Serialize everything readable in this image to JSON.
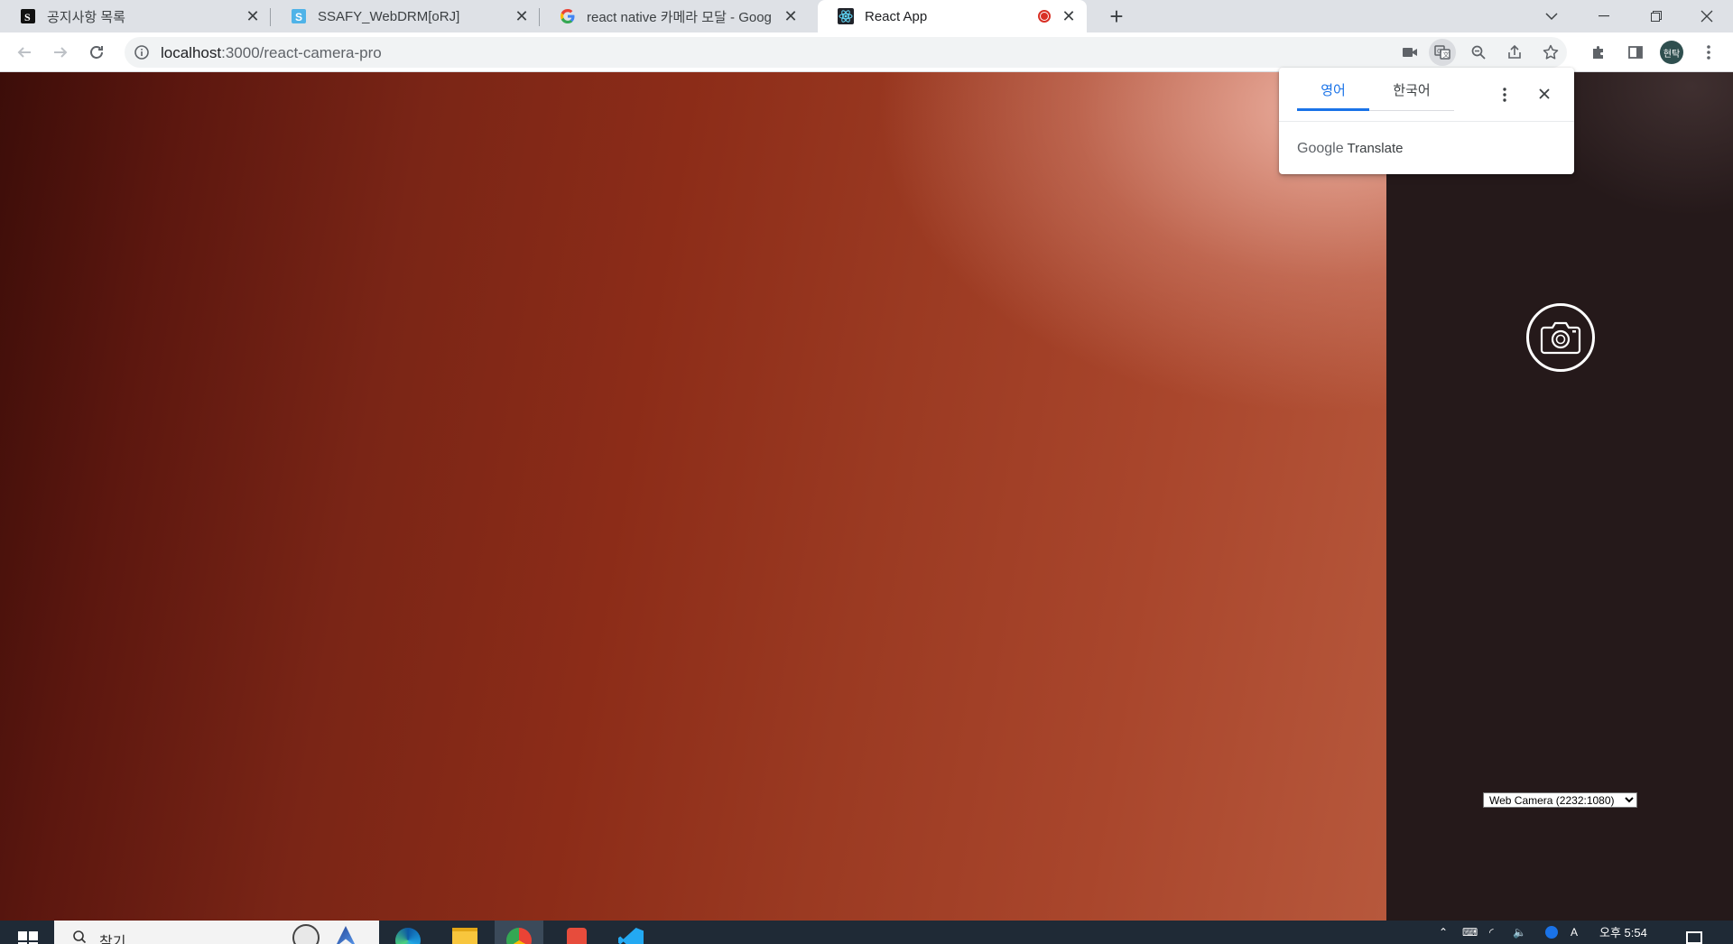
{
  "tabs": [
    {
      "title": "공지사항 목록",
      "favicon": "notion-icon"
    },
    {
      "title": "SSAFY_WebDRM[oRJ]",
      "favicon": "document-icon"
    },
    {
      "title": "react native 카메라 모달 - Goog",
      "favicon": "google-icon"
    },
    {
      "title": "React App",
      "favicon": "react-icon",
      "recording": true
    }
  ],
  "toolbar": {
    "url_host": "localhost",
    "url_path": ":3000/react-camera-pro"
  },
  "profile": {
    "initials": "현탁"
  },
  "translate_popup": {
    "source_lang": "영어",
    "target_lang": "한국어",
    "brand_google": "Google",
    "brand_translate": "Translate"
  },
  "camera": {
    "device_option": "Web Camera (2232:1080)"
  },
  "taskbar": {
    "search_placeholder": "찾기",
    "clock": "오후 5:54",
    "ime": "A"
  },
  "colors": {
    "accent": "#1a73e8",
    "recording": "#d93025",
    "panel": "#25191a"
  }
}
